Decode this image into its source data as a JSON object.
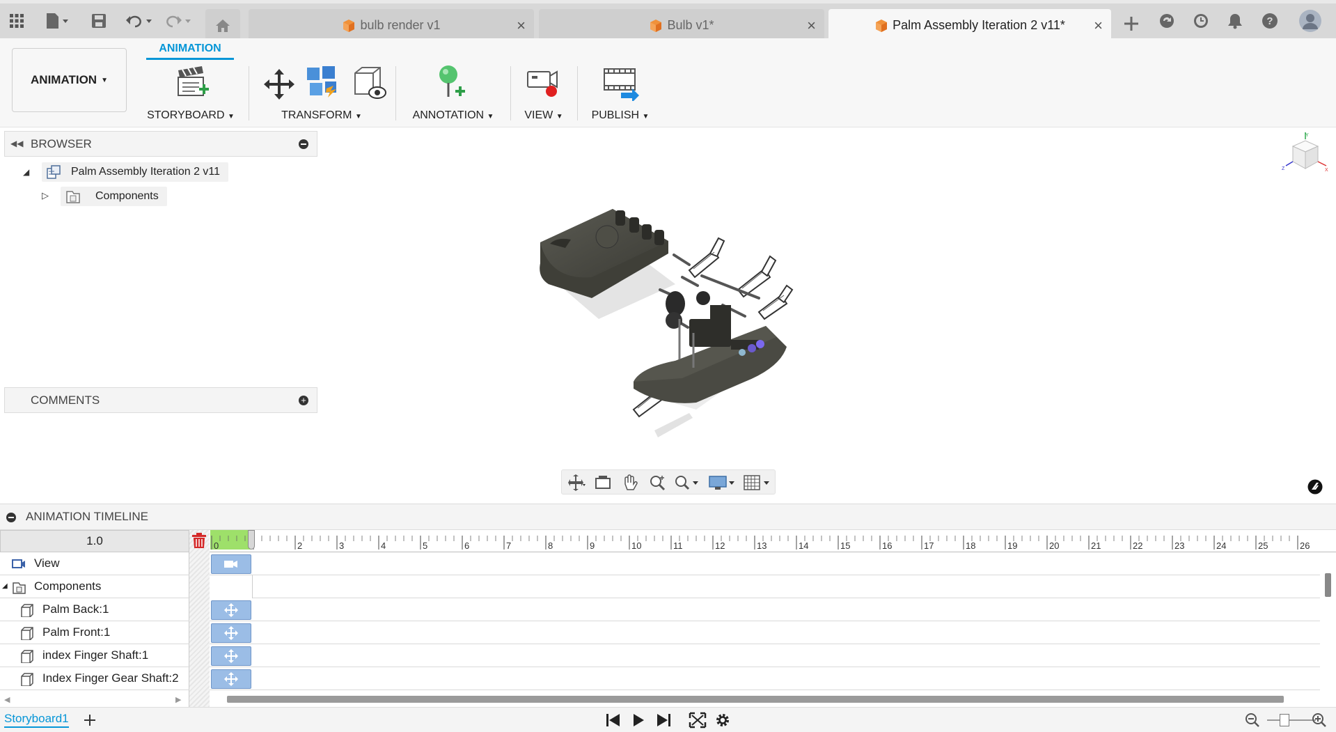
{
  "tabs": [
    {
      "label": "bulb render v1",
      "active": false
    },
    {
      "label": "Bulb v1*",
      "active": false
    },
    {
      "label": "Palm Assembly Iteration 2 v11*",
      "active": true
    }
  ],
  "toolbar": {
    "workspace_label": "ANIMATION",
    "workspace_tab": "ANIMATION",
    "groups": [
      {
        "label": "STORYBOARD",
        "icon": "storyboard-clapper-icon"
      },
      {
        "label": "TRANSFORM",
        "icon": "transform-icon"
      },
      {
        "label": "ANNOTATION",
        "icon": "annotation-pin-icon"
      },
      {
        "label": "VIEW",
        "icon": "view-record-icon"
      },
      {
        "label": "PUBLISH",
        "icon": "publish-film-icon"
      }
    ]
  },
  "browser": {
    "title": "BROWSER",
    "root": "Palm Assembly Iteration 2 v11",
    "child": "Components"
  },
  "comments": {
    "title": "COMMENTS"
  },
  "timeline": {
    "title": "ANIMATION TIMELINE",
    "speed": "1.0",
    "rows": [
      {
        "label": "View",
        "icon": "camera-view-icon"
      },
      {
        "label": "Components",
        "icon": "components-icon"
      },
      {
        "label": "Palm Back:1",
        "icon": "component-icon"
      },
      {
        "label": "Palm Front:1",
        "icon": "component-icon"
      },
      {
        "label": "index Finger Shaft:1",
        "icon": "component-icon"
      },
      {
        "label": "Index Finger Gear Shaft:2",
        "icon": "component-icon"
      }
    ],
    "ticks": [
      "0",
      "2",
      "3",
      "4",
      "5",
      "6",
      "7",
      "8",
      "9",
      "10",
      "11",
      "12",
      "13",
      "14",
      "15",
      "16",
      "17",
      "18",
      "19",
      "20",
      "21",
      "22",
      "23",
      "24",
      "25",
      "26"
    ]
  },
  "bottom": {
    "storyboard": "Storyboard1"
  },
  "colors": {
    "accent": "#0696d7",
    "keyframe": "#9bbde6",
    "ruler_green": "#9ee06a"
  }
}
